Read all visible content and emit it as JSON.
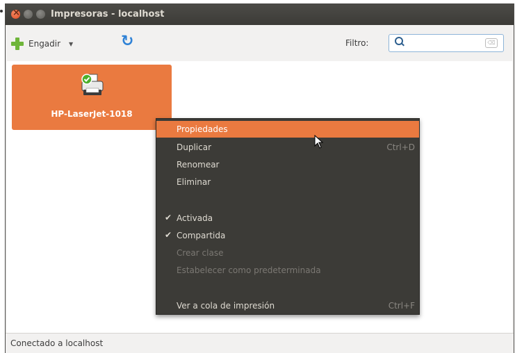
{
  "window": {
    "title": "Impresoras - localhost"
  },
  "toolbar": {
    "add_label": "Engadir",
    "filter_label": "Filtro:",
    "filter_value": ""
  },
  "printer": {
    "name": "HP-LaserJet-1018"
  },
  "context_menu": {
    "items": [
      {
        "label": "Propiedades",
        "accel": "",
        "checked": false,
        "disabled": false,
        "highlighted": true
      },
      {
        "label": "Duplicar",
        "accel": "Ctrl+D",
        "checked": false,
        "disabled": false,
        "highlighted": false
      },
      {
        "label": "Renomear",
        "accel": "",
        "checked": false,
        "disabled": false,
        "highlighted": false
      },
      {
        "label": "Eliminar",
        "accel": "",
        "checked": false,
        "disabled": false,
        "highlighted": false
      },
      {
        "label": "Activada",
        "accel": "",
        "checked": true,
        "disabled": false,
        "highlighted": false
      },
      {
        "label": "Compartida",
        "accel": "",
        "checked": true,
        "disabled": false,
        "highlighted": false
      },
      {
        "label": "Crear clase",
        "accel": "",
        "checked": false,
        "disabled": true,
        "highlighted": false
      },
      {
        "label": "Estabelecer como predeterminada",
        "accel": "",
        "checked": false,
        "disabled": true,
        "highlighted": false
      },
      {
        "label": "Ver a cola de impresión",
        "accel": "Ctrl+F",
        "checked": false,
        "disabled": false,
        "highlighted": false
      }
    ],
    "check_glyph": "✔"
  },
  "status_bar": {
    "text": "Conectado a localhost"
  },
  "colors": {
    "accent": "#ea7a40",
    "menu_bg": "#3c3b37",
    "titlebar_bg": "#3c3b37"
  }
}
